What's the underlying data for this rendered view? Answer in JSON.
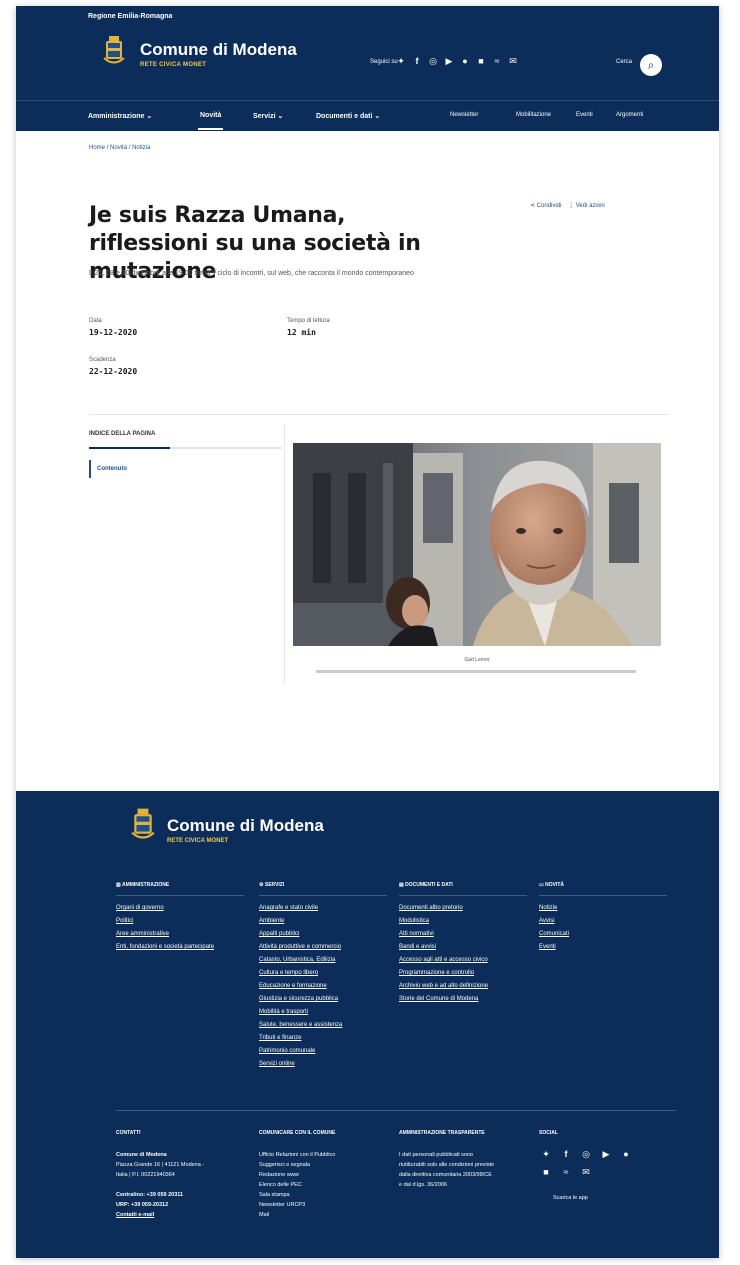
{
  "slim_header": {
    "region": "Regione Emilia-Romagna"
  },
  "brand": {
    "name": "Comune di Modena",
    "subtitle": "RETE CIVICA MONET"
  },
  "social": {
    "label": "Seguici su",
    "icons": [
      "twitter-icon",
      "facebook-icon",
      "instagram-icon",
      "youtube-icon",
      "telegram-icon",
      "whatsapp-icon",
      "wifi-icon",
      "mail-icon"
    ]
  },
  "search": {
    "label": "Cerca"
  },
  "nav": {
    "main": [
      "Amministrazione",
      "Novità",
      "Servizi",
      "Documenti e dati"
    ],
    "secondary": [
      "Newsletter",
      "Mobilitazione",
      "Eventi",
      "Argomenti"
    ]
  },
  "breadcrumb": {
    "home": "Home",
    "sep": "/",
    "section": "Novità",
    "current": "Notizia"
  },
  "article": {
    "title": "Je suis Razza Umana, riflessioni su una società in mutazione",
    "lead": "Il 21, 28 e 30 dicembre alle 19.00 torna il ciclo di incontri, sul web, che racconta il mondo contemporaneo",
    "share": "Condividi",
    "more": "Vedi azioni",
    "date_label": "Data",
    "date_value": "19-12-2020",
    "reading_label": "Tempo di lettura",
    "reading_value": "12 min",
    "deadline_label": "Scadenza",
    "deadline_value": "22-12-2020",
    "toc_title": "INDICE DELLA PAGINA",
    "toc_item": "Contenuto",
    "toc_progress": 0.42,
    "caption": "Gad Lerner"
  },
  "footer": {
    "columns": [
      {
        "heading": "AMMINISTRAZIONE",
        "items": [
          "Organi di governo",
          "Politici",
          "Aree amministrative",
          "Enti, fondazioni e società partecipate"
        ]
      },
      {
        "heading": "SERVIZI",
        "items": [
          "Anagrafe e stato civile",
          "Ambiente",
          "Appalti pubblici",
          "Attività produttive e commercio",
          "Catasto, Urbanistica, Edilizia",
          "Cultura e tempo libero",
          "Educazione e formazione",
          "Giustizia e sicurezza pubblica",
          "Mobilità e trasporti",
          "Salute, benessere e assistenza",
          "Tributi e finanze",
          "Patrimonio comunale",
          "Servizi online"
        ]
      },
      {
        "heading": "DOCUMENTI E DATI",
        "items": [
          "Documenti albo pretorio",
          "Modulistica",
          "Atti normativi",
          "Bandi e avvisi",
          "Accesso agli atti e accesso civico",
          "Programmazione e controllo",
          "Archivio web e ad alto definizione",
          "Storie del Comune di Modena"
        ]
      },
      {
        "heading": "NOVITÀ",
        "items": [
          "Notizie",
          "Avvisi",
          "Comunicati",
          "Eventi"
        ]
      }
    ],
    "bottom": {
      "contacts_heading": "CONTATTI",
      "contacts": [
        "Comune di Modena",
        "Piazza Grande 16 | 41121 Modena -",
        "Italia | P.I. 00221940364",
        "",
        "Centralino: +39 059 20311",
        "URP: +39 059-20312",
        "Contatti e-mail"
      ],
      "comm_heading": "COMUNICARE CON IL COMUNE",
      "comm": [
        "Ufficio Relazioni con il Pubblico",
        "Suggerisci e segnala",
        "Redazione www",
        "Elenco delle PEC",
        "Sala stampa",
        "Newsletter URCP3",
        "Mail"
      ],
      "transparency_heading": "AMMINISTRAZIONE TRASPARENTE",
      "transparency": [
        "I dati personali pubblicati sono",
        "riutilizzabili solo alle condizioni previste",
        "dalla direttiva comunitaria 2003/98/CE",
        "e dal d.lgs. 36/2006"
      ],
      "social_heading": "SOCIAL",
      "app": "Scarica le app"
    }
  }
}
